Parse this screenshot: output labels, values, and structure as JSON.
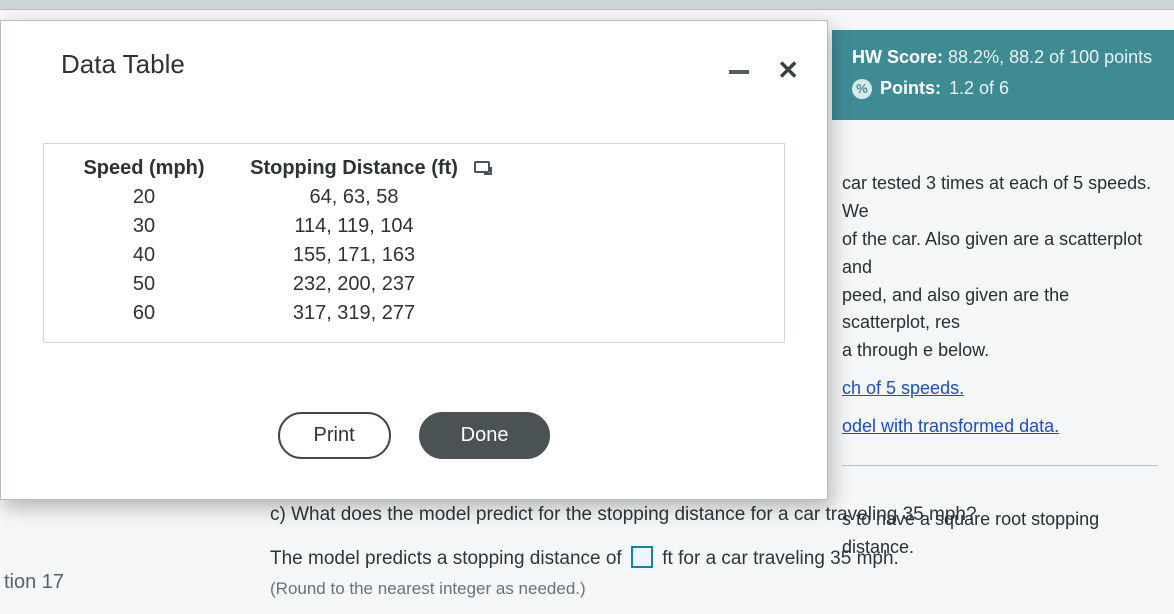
{
  "modal": {
    "title": "Data Table",
    "print_label": "Print",
    "done_label": "Done"
  },
  "table": {
    "head": {
      "c1": "Speed (mph)",
      "c2": "Stopping Distance (ft)"
    },
    "rows": [
      {
        "c1": "20",
        "c2": "64, 63, 58"
      },
      {
        "c1": "30",
        "c2": "114, 119, 104"
      },
      {
        "c1": "40",
        "c2": "155, 171, 163"
      },
      {
        "c1": "50",
        "c2": "232, 200, 237"
      },
      {
        "c1": "60",
        "c2": "317, 319, 277"
      }
    ]
  },
  "score": {
    "hw_label": "HW Score:",
    "hw_value": "88.2%, 88.2 of 100 points",
    "pts_label": "Points:",
    "pts_value": "1.2 of 6"
  },
  "problem": {
    "frag1": "car tested 3 times at each of 5 speeds. We",
    "frag2": "of the car. Also given are a scatterplot and",
    "frag3": "peed, and also given are the scatterplot, res",
    "frag4": "a through e below.",
    "link1": "ch of 5 speeds.",
    "link2": "odel with transformed data.",
    "frag5": "s to have a square root stopping distance."
  },
  "question": {
    "part": "c) What does the model predict for the stopping distance for a car traveling 35 mph?",
    "ans_before": "The model predicts a stopping distance of",
    "ans_after": "ft for a car traveling 35 mph.",
    "hint": "(Round to the nearest integer as needed.)"
  },
  "nav": {
    "item": "tion 17"
  }
}
